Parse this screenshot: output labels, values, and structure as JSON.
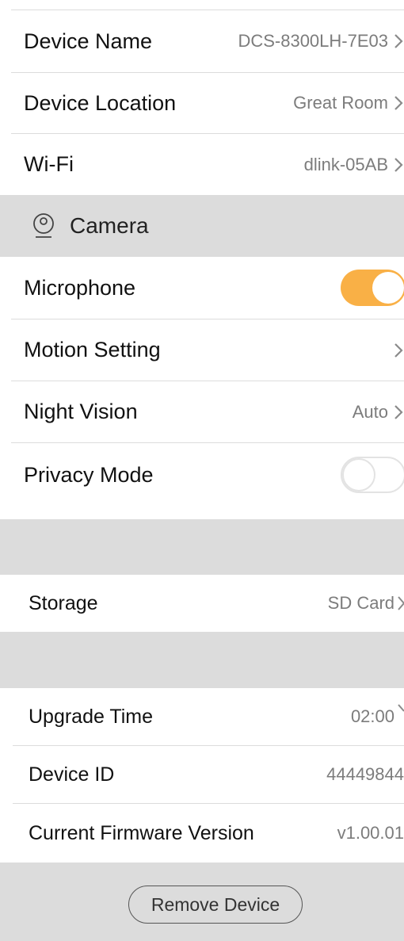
{
  "device": {
    "name_label": "Device Name",
    "name_value": "DCS-8300LH-7E03",
    "location_label": "Device Location",
    "location_value": "Great Room",
    "wifi_label": "Wi-Fi",
    "wifi_value": "dlink-05AB"
  },
  "camera": {
    "section_title": "Camera",
    "section_icon": "camera-icon",
    "microphone_label": "Microphone",
    "microphone_on": true,
    "motion_label": "Motion Setting",
    "night_vision_label": "Night Vision",
    "night_vision_value": "Auto",
    "privacy_label": "Privacy Mode",
    "privacy_on": false
  },
  "storage": {
    "label": "Storage",
    "value": "SD Card"
  },
  "firmware": {
    "upgrade_time_label": "Upgrade Time",
    "upgrade_time_value": "02:00",
    "device_id_label": "Device ID",
    "device_id_value": "44449844",
    "version_label": "Current Firmware Version",
    "version_value": "v1.00.01"
  },
  "actions": {
    "remove_device": "Remove Device"
  },
  "colors": {
    "toggle_on": "#f9b046",
    "band_gray": "#dcdcdc"
  }
}
